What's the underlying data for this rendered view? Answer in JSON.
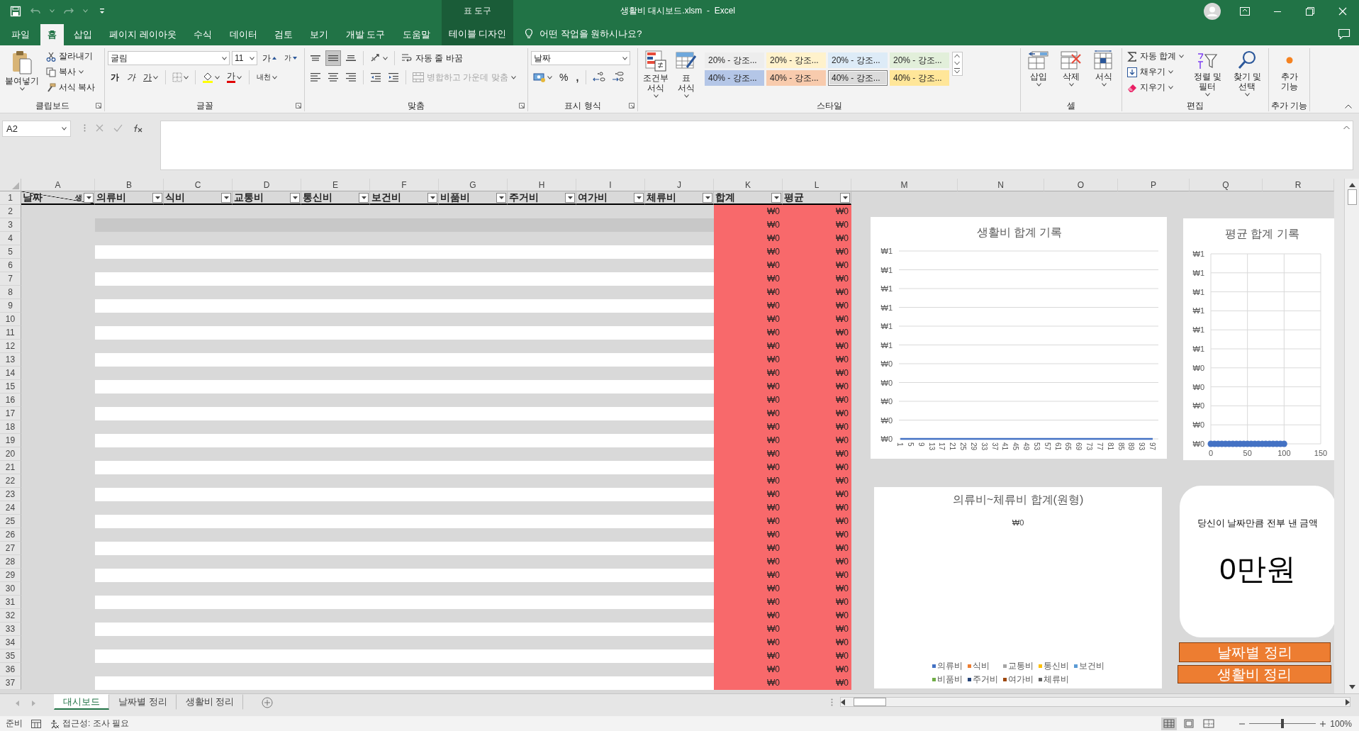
{
  "title_bar": {
    "context_tab_group": "표 도구",
    "title": "생활비 대시보드.xlsm  -  Excel"
  },
  "quick_access": [
    {
      "kind": "save",
      "disabled": false
    },
    {
      "kind": "undo",
      "disabled": true
    },
    {
      "kind": "redo",
      "disabled": true
    },
    {
      "kind": "customize",
      "disabled": false
    }
  ],
  "menu_tabs": [
    {
      "label": "파일",
      "selected": false,
      "kind": "standard"
    },
    {
      "label": "홈",
      "selected": true,
      "kind": "standard"
    },
    {
      "label": "삽입",
      "selected": false,
      "kind": "standard"
    },
    {
      "label": "페이지 레이아웃",
      "selected": false,
      "kind": "standard"
    },
    {
      "label": "수식",
      "selected": false,
      "kind": "standard"
    },
    {
      "label": "데이터",
      "selected": false,
      "kind": "standard"
    },
    {
      "label": "검토",
      "selected": false,
      "kind": "standard"
    },
    {
      "label": "보기",
      "selected": false,
      "kind": "standard"
    },
    {
      "label": "개발 도구",
      "selected": false,
      "kind": "standard"
    },
    {
      "label": "도움말",
      "selected": false,
      "kind": "standard"
    },
    {
      "label": "테이블 디자인",
      "selected": false,
      "kind": "contextual"
    }
  ],
  "tell_me": {
    "placeholder": "어떤 작업을 원하시나요?"
  },
  "ribbon": {
    "clipboard": {
      "label": "클립보드",
      "paste": "붙여넣기",
      "cut": "잘라내기",
      "copy": "복사",
      "format_painter": "서식 복사"
    },
    "font": {
      "label": "글꼴",
      "font_name": "굴림",
      "font_size": "11",
      "grow": "가",
      "shrink": "가",
      "bold": "가",
      "italic": "가",
      "underline": "가",
      "font_color": "가",
      "phonetic": "내천"
    },
    "alignment": {
      "label": "맞춤",
      "vertical_align": [
        {
          "selected": false
        },
        {
          "selected": true
        },
        {
          "selected": false
        }
      ],
      "wrap_text": "자동 줄 바꿈",
      "merge_center": {
        "label": "병합하고 가운데 맞춤",
        "disabled": true
      }
    },
    "number": {
      "label": "표시 형식",
      "format": "날짜",
      "percent": "%",
      "comma": ","
    },
    "styles": {
      "label": "스타일",
      "conditional": "조건부 서식",
      "format_table": "표 서식",
      "gallery": [
        {
          "label": "20% - 강조...",
          "color": "#ededed",
          "selected": false
        },
        {
          "label": "20% - 강조...",
          "color": "#fff2cc",
          "selected": false
        },
        {
          "label": "20% - 강조...",
          "color": "#ddebf7",
          "selected": false
        },
        {
          "label": "20% - 강조...",
          "color": "#e2efda",
          "selected": false
        },
        {
          "label": "40% - 강조...",
          "color": "#b4c6e7",
          "selected": false
        },
        {
          "label": "40% - 강조...",
          "color": "#f8cbad",
          "selected": false
        },
        {
          "label": "40% - 강조...",
          "color": "#dbdbdb",
          "selected": true
        },
        {
          "label": "40% - 강조...",
          "color": "#ffe699",
          "selected": false
        }
      ]
    },
    "cells": {
      "label": "셀",
      "insert": "삽입",
      "delete": "삭제",
      "format": "서식"
    },
    "editing": {
      "label": "편집",
      "autosum": "자동 합계",
      "fill": "채우기",
      "clear": "지우기",
      "sort_filter": "정렬 및 필터",
      "find_select": "찾기 및 선택"
    },
    "addins": {
      "label": "추가 기능",
      "button": "추가 기능"
    }
  },
  "formula_bar": {
    "name_box": "A2"
  },
  "sheet": {
    "columns": [
      "A",
      "B",
      "C",
      "D",
      "E",
      "F",
      "G",
      "H",
      "I",
      "J",
      "K",
      "L",
      "M",
      "N",
      "O",
      "P",
      "Q",
      "R"
    ],
    "header_row": {
      "number": "1",
      "date_header": {
        "label": "날짜",
        "corner_label": "생"
      },
      "headers": [
        "의류비",
        "식비",
        "교통비",
        "통신비",
        "보건비",
        "비품비",
        "주거비",
        "여가비",
        "체류비",
        "합계",
        "평균"
      ]
    },
    "rows": [
      {
        "number": "2",
        "total": "₩0",
        "average": "₩0"
      },
      {
        "number": "3",
        "total": "₩0",
        "average": "₩0"
      },
      {
        "number": "4",
        "total": "₩0",
        "average": "₩0"
      },
      {
        "number": "5",
        "total": "₩0",
        "average": "₩0"
      },
      {
        "number": "6",
        "total": "₩0",
        "average": "₩0"
      },
      {
        "number": "7",
        "total": "₩0",
        "average": "₩0"
      },
      {
        "number": "8",
        "total": "₩0",
        "average": "₩0"
      },
      {
        "number": "9",
        "total": "₩0",
        "average": "₩0"
      },
      {
        "number": "10",
        "total": "₩0",
        "average": "₩0"
      },
      {
        "number": "11",
        "total": "₩0",
        "average": "₩0"
      },
      {
        "number": "12",
        "total": "₩0",
        "average": "₩0"
      },
      {
        "number": "13",
        "total": "₩0",
        "average": "₩0"
      },
      {
        "number": "14",
        "total": "₩0",
        "average": "₩0"
      },
      {
        "number": "15",
        "total": "₩0",
        "average": "₩0"
      },
      {
        "number": "16",
        "total": "₩0",
        "average": "₩0"
      },
      {
        "number": "17",
        "total": "₩0",
        "average": "₩0"
      },
      {
        "number": "18",
        "total": "₩0",
        "average": "₩0"
      },
      {
        "number": "19",
        "total": "₩0",
        "average": "₩0"
      },
      {
        "number": "20",
        "total": "₩0",
        "average": "₩0"
      },
      {
        "number": "21",
        "total": "₩0",
        "average": "₩0"
      },
      {
        "number": "22",
        "total": "₩0",
        "average": "₩0"
      },
      {
        "number": "23",
        "total": "₩0",
        "average": "₩0"
      },
      {
        "number": "24",
        "total": "₩0",
        "average": "₩0"
      },
      {
        "number": "25",
        "total": "₩0",
        "average": "₩0"
      },
      {
        "number": "26",
        "total": "₩0",
        "average": "₩0"
      },
      {
        "number": "27",
        "total": "₩0",
        "average": "₩0"
      },
      {
        "number": "28",
        "total": "₩0",
        "average": "₩0"
      },
      {
        "number": "29",
        "total": "₩0",
        "average": "₩0"
      },
      {
        "number": "30",
        "total": "₩0",
        "average": "₩0"
      },
      {
        "number": "31",
        "total": "₩0",
        "average": "₩0"
      },
      {
        "number": "32",
        "total": "₩0",
        "average": "₩0"
      },
      {
        "number": "33",
        "total": "₩0",
        "average": "₩0"
      },
      {
        "number": "34",
        "total": "₩0",
        "average": "₩0"
      },
      {
        "number": "35",
        "total": "₩0",
        "average": "₩0"
      },
      {
        "number": "36",
        "total": "₩0",
        "average": "₩0"
      },
      {
        "number": "37",
        "total": "₩0",
        "average": "₩0"
      }
    ]
  },
  "line_chart": {
    "chart_data": {
      "type": "line",
      "title": "생활비 합계 기록",
      "categories": [
        "1",
        "5",
        "9",
        "13",
        "17",
        "21",
        "25",
        "29",
        "33",
        "37",
        "41",
        "45",
        "49",
        "53",
        "57",
        "61",
        "65",
        "69",
        "73",
        "77",
        "81",
        "85",
        "89",
        "93",
        "97"
      ],
      "values": [
        0,
        0,
        0,
        0,
        0,
        0,
        0,
        0,
        0,
        0,
        0,
        0,
        0,
        0,
        0,
        0,
        0,
        0,
        0,
        0,
        0,
        0,
        0,
        0,
        0
      ],
      "ylim": [
        0,
        1
      ],
      "grid": true,
      "yticks": [
        {
          "value": 0,
          "label": "₩0"
        },
        {
          "value": 0.1,
          "label": "₩0"
        },
        {
          "value": 0.2,
          "label": "₩0"
        },
        {
          "value": 0.3,
          "label": "₩0"
        },
        {
          "value": 0.4,
          "label": "₩0"
        },
        {
          "value": 0.5,
          "label": "₩1"
        },
        {
          "value": 0.6,
          "label": "₩1"
        },
        {
          "value": 0.7,
          "label": "₩1"
        },
        {
          "value": 0.8,
          "label": "₩1"
        },
        {
          "value": 0.9,
          "label": "₩1"
        },
        {
          "value": 1,
          "label": "₩1"
        }
      ]
    }
  },
  "scatter_chart": {
    "chart_data": {
      "type": "scatter",
      "title": "평균 합계 기록",
      "x": [
        0,
        5,
        10,
        15,
        20,
        25,
        30,
        35,
        40,
        45,
        50,
        55,
        60,
        65,
        70,
        75,
        80,
        85,
        90,
        95,
        100
      ],
      "values": [
        0,
        0,
        0,
        0,
        0,
        0,
        0,
        0,
        0,
        0,
        0,
        0,
        0,
        0,
        0,
        0,
        0,
        0,
        0,
        0,
        0
      ],
      "xlim": [
        0,
        150
      ],
      "xticks": [
        0,
        50,
        100,
        150
      ],
      "ylim": [
        0,
        1
      ],
      "grid": true,
      "yticks": [
        {
          "value": 0,
          "label": "₩0"
        },
        {
          "value": 0.1,
          "label": "₩0"
        },
        {
          "value": 0.2,
          "label": "₩0"
        },
        {
          "value": 0.3,
          "label": "₩0"
        },
        {
          "value": 0.4,
          "label": "₩0"
        },
        {
          "value": 0.5,
          "label": "₩1"
        },
        {
          "value": 0.6,
          "label": "₩1"
        },
        {
          "value": 0.7,
          "label": "₩1"
        },
        {
          "value": 0.8,
          "label": "₩1"
        },
        {
          "value": 0.9,
          "label": "₩1"
        },
        {
          "value": 1,
          "label": "₩1"
        }
      ]
    }
  },
  "pie_chart": {
    "title": "의류비~체류비 합계(원형)",
    "data_labels": [
      "₩0"
    ],
    "legend": [
      {
        "label": "의류비",
        "color": "#4472c4"
      },
      {
        "label": "식비",
        "color": "#ed7d31"
      },
      {
        "label": "교통비",
        "color": "#a5a5a5"
      },
      {
        "label": "통신비",
        "color": "#ffc000"
      },
      {
        "label": "보건비",
        "color": "#5b9bd5"
      },
      {
        "label": "비품비",
        "color": "#70ad47"
      },
      {
        "label": "주거비",
        "color": "#264478"
      },
      {
        "label": "여가비",
        "color": "#9e480e"
      },
      {
        "label": "체류비",
        "color": "#636363"
      }
    ]
  },
  "summary_card": {
    "caption": "당신이 날짜만큼 전부 낸 금액",
    "amount": "0만원"
  },
  "action_buttons": [
    "날짜별 정리",
    "생활비 정리"
  ],
  "sheet_tabs": [
    {
      "label": "대시보드",
      "selected": true
    },
    {
      "label": "날짜별 정리",
      "selected": false
    },
    {
      "label": "생활비 정리",
      "selected": false
    }
  ],
  "status_bar": {
    "mode": "준비",
    "accessibility": "접근성: 조사 필요",
    "views": [
      {
        "selected": true
      },
      {
        "selected": false
      },
      {
        "selected": false
      }
    ],
    "zoom": {
      "label": "100%",
      "level": 0.5
    }
  }
}
